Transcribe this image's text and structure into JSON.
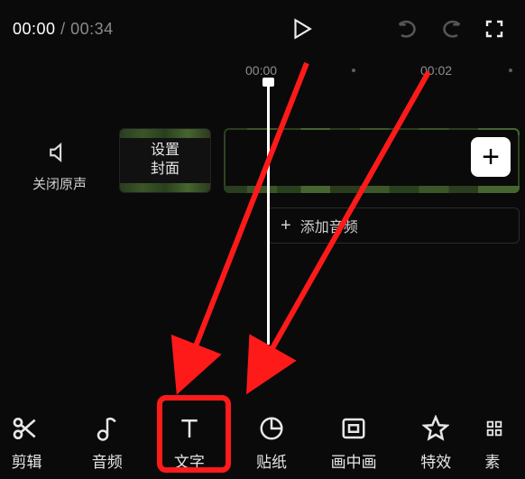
{
  "playback": {
    "current": "00:00",
    "total": "00:34"
  },
  "ruler": {
    "t0": "00:00",
    "t1": "00:02"
  },
  "mute_label": "关闭原声",
  "cover_label_line1": "设置",
  "cover_label_line2": "封面",
  "add_clip_glyph": "+",
  "add_audio": {
    "glyph": "+",
    "label": "添加音频"
  },
  "tools": {
    "cut": "剪辑",
    "audio": "音频",
    "text": "文字",
    "sticker": "贴纸",
    "pip": "画中画",
    "effect": "特效",
    "more": "素"
  }
}
